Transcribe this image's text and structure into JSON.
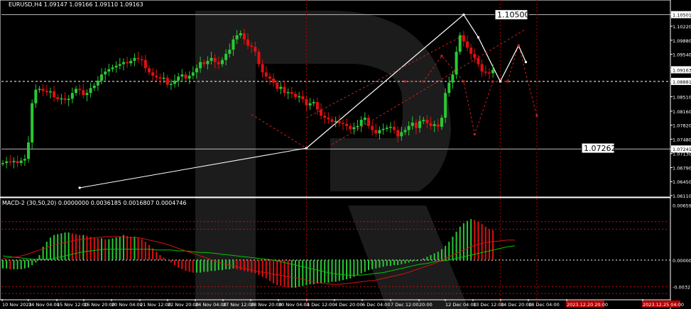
{
  "colors": {
    "background": "#000000",
    "bull": "#29c934",
    "bear": "#e01010",
    "axis_text": "#ffffff",
    "hline": "#ffffff",
    "forecast_white": "#ffffff",
    "forecast_red": "#cc1f1f",
    "macd_signal": "#00c800",
    "macd_line": "#d21414",
    "level_red": "#c41010",
    "vline_red": "#b00000"
  },
  "header": {
    "symbol_info": "EURUSD,H4  1.09147 1.09166 1.09110 1.09163",
    "macd_info": "MACD-2 (30,50,20) 0.0000000 0.0036185 0.0016807 0.0004746"
  },
  "chart_data": [
    {
      "type": "line",
      "name": "price",
      "ylim": [
        1.0611,
        1.1065
      ],
      "price_axis_labels": [
        "1.10501",
        "1.10220",
        "1.09880",
        "1.09540",
        "1.09163",
        "1.08881",
        "1.08510",
        "1.08160",
        "1.07820",
        "1.07480",
        "1.07241",
        "1.07130",
        "1.06790",
        "1.06450",
        "1.06110"
      ],
      "price_axis_values": [
        1.10501,
        1.1022,
        1.0988,
        1.0954,
        1.09163,
        1.08881,
        1.0851,
        1.0816,
        1.0782,
        1.0748,
        1.07241,
        1.0713,
        1.0679,
        1.0645,
        1.0611
      ],
      "highlighted_prices": [
        "1.10501",
        "1.09163",
        "1.08881",
        "1.07241"
      ],
      "level_lines": [
        1.10501,
        1.08881,
        1.07241
      ],
      "annotations": [
        {
          "text": "1.10500",
          "price": 1.105
        },
        {
          "text": "1.07262",
          "price": 1.07262
        }
      ],
      "x_tick_labels": [
        "10 Nov 2023",
        "14 Nov 04:00",
        "15 Nov 12:00",
        "16 Nov 20:00",
        "20 Nov 04:00",
        "21 Nov 12:00",
        "22 Nov 20:00",
        "24 Nov 04:00",
        "27 Nov 12:00",
        "28 Nov 20:00",
        "30 Nov 04:00",
        "1 Dec 12:00",
        "4 Dec 20:00",
        "6 Dec 04:00",
        "7 Dec 12:00",
        "20:00",
        "12 Dec 04:00",
        "13 Dec 12:00",
        "14 Dec 20:00",
        "18 Dec 04:00",
        "2023.12.20 20:00",
        "2023.12.25 04:00"
      ],
      "red_x_tags": [
        "2023.12.07 12:00",
        "2023.12.20 20:00",
        "2023.12.25 04:00"
      ],
      "close_series": [
        1.069,
        1.0694,
        1.0692,
        1.0695,
        1.069,
        1.0696,
        1.07,
        1.074,
        1.0835,
        1.0868,
        1.087,
        1.0865,
        1.0862,
        1.0864,
        1.085,
        1.0845,
        1.0847,
        1.0843,
        1.0846,
        1.086,
        1.087,
        1.0867,
        1.0855,
        1.086,
        1.0872,
        1.0878,
        1.089,
        1.0905,
        1.0912,
        1.0918,
        1.0922,
        1.0926,
        1.093,
        1.0935,
        1.0932,
        1.0938,
        1.0945,
        1.0942,
        1.094,
        1.092,
        1.091,
        1.0902,
        1.0898,
        1.0895,
        1.0897,
        1.088,
        1.0882,
        1.089,
        1.09,
        1.0905,
        1.0895,
        1.0902,
        1.091,
        1.092,
        1.0935,
        1.093,
        1.0938,
        1.0945,
        1.0935,
        1.093,
        1.094,
        1.0955,
        1.0965,
        1.099,
        1.1,
        1.1005,
        1.099,
        1.0975,
        1.0972,
        1.096,
        1.093,
        1.091,
        1.09,
        1.0895,
        1.0885,
        1.087,
        1.0875,
        1.086,
        1.0862,
        1.0858,
        1.085,
        1.0852,
        1.0845,
        1.083,
        1.0835,
        1.0838,
        1.082,
        1.0805,
        1.08,
        1.0796,
        1.079,
        1.0792,
        1.0787,
        1.0785,
        1.078,
        1.0772,
        1.0777,
        1.078,
        1.0795,
        1.08,
        1.078,
        1.077,
        1.0762,
        1.077,
        1.0773,
        1.0776,
        1.0778,
        1.077,
        1.0755,
        1.0765,
        1.077,
        1.078,
        1.0788,
        1.0775,
        1.0792,
        1.0795,
        1.0787,
        1.078,
        1.0784,
        1.0778,
        1.08,
        1.086,
        1.0885,
        1.0905,
        1.096,
        1.1,
        1.0985,
        1.097,
        1.0955,
        1.0945,
        1.093,
        1.0912,
        1.091,
        1.0908,
        1.0916
      ],
      "forecast_white_path": [
        {
          "bar": 83,
          "price": 1.07262
        },
        {
          "bar": 126,
          "price": 1.105
        },
        {
          "bar": 130,
          "price": 1.0995
        },
        {
          "bar": 136,
          "price": 1.0888
        },
        {
          "bar": 141,
          "price": 1.0975
        },
        {
          "bar": 143,
          "price": 1.0935
        }
      ],
      "forecast_red_path": [
        {
          "bar": 110,
          "price": 1.0888
        },
        {
          "bar": 115,
          "price": 1.0888
        },
        {
          "bar": 120,
          "price": 1.095
        },
        {
          "bar": 126,
          "price": 1.0888
        },
        {
          "bar": 129,
          "price": 1.076
        },
        {
          "bar": 134,
          "price": 1.0888
        },
        {
          "bar": 138,
          "price": 1.0888
        },
        {
          "bar": 141,
          "price": 1.0975
        },
        {
          "bar": 146,
          "price": 1.0805
        }
      ],
      "long_white_line": [
        {
          "bar": 21,
          "price": 1.063
        },
        {
          "bar": 83,
          "price": 1.07262
        }
      ]
    },
    {
      "type": "bar",
      "name": "MACD-2 (30,50,20)",
      "ylim": [
        -0.0045,
        0.0067
      ],
      "axis_labels": [
        "0.0065927",
        "0.0000014",
        "-0.0032"
      ],
      "histogram": [
        -0.001,
        -0.001,
        -0.0011,
        -0.0011,
        -0.0011,
        -0.0011,
        -0.001,
        -0.0009,
        -0.0006,
        -0.0003,
        0.0006,
        0.0016,
        0.0022,
        0.0027,
        0.003,
        0.0031,
        0.0032,
        0.0033,
        0.0033,
        0.0032,
        0.0031,
        0.003,
        0.003,
        0.0029,
        0.0028,
        0.0027,
        0.0026,
        0.0026,
        0.0025,
        0.0025,
        0.0026,
        0.0027,
        0.0028,
        0.003,
        0.0029,
        0.0028,
        0.0028,
        0.0027,
        0.0025,
        0.0022,
        0.0018,
        0.0014,
        0.001,
        0.0006,
        0.0003,
        0.0,
        -0.0003,
        -0.0006,
        -0.0009,
        -0.0011,
        -0.0013,
        -0.0014,
        -0.0015,
        -0.0015,
        -0.0015,
        -0.0014,
        -0.0014,
        -0.0013,
        -0.0013,
        -0.0012,
        -0.0012,
        -0.0011,
        -0.0011,
        -0.001,
        -0.0011,
        -0.0012,
        -0.0013,
        -0.0014,
        -0.0015,
        -0.0016,
        -0.0018,
        -0.002,
        -0.0022,
        -0.0025,
        -0.0028,
        -0.003,
        -0.0031,
        -0.0032,
        -0.0033,
        -0.0033,
        -0.0033,
        -0.0032,
        -0.0031,
        -0.003,
        -0.0029,
        -0.0029,
        -0.0028,
        -0.0028,
        -0.0027,
        -0.0027,
        -0.0026,
        -0.0026,
        -0.0025,
        -0.0024,
        -0.0023,
        -0.0022,
        -0.002,
        -0.0018,
        -0.0016,
        -0.0014,
        -0.0012,
        -0.0011,
        -0.001,
        -0.0009,
        -0.0008,
        -0.0007,
        -0.0007,
        -0.0006,
        -0.0006,
        -0.0005,
        -0.0004,
        -0.0003,
        -0.0002,
        -0.0001,
        0.0,
        0.0002,
        0.0004,
        0.0006,
        0.0008,
        0.001,
        0.0013,
        0.0017,
        0.0022,
        0.0028,
        0.0034,
        0.004,
        0.0044,
        0.0047,
        0.0049,
        0.0048,
        0.0046,
        0.0043,
        0.004,
        0.0037,
        0.0036
      ],
      "signal_line": [
        0.0005,
        0.0004,
        0.0003,
        0.0002,
        0.0001,
        0.0001,
        0.0001,
        0.0002,
        0.0004,
        0.0006,
        0.0008,
        0.001,
        0.0011,
        0.0012,
        0.0013,
        0.0013,
        0.0013,
        0.0013,
        0.0013,
        0.0013,
        0.0013,
        0.0012,
        0.0012,
        0.0012,
        0.0011,
        0.0011,
        0.001,
        0.0009,
        0.0009,
        0.0008,
        0.0007,
        0.0006,
        0.0005,
        0.0004,
        0.0003,
        0.0002,
        0.0001,
        0.0,
        -0.0002,
        -0.0004,
        -0.0006,
        -0.0008,
        -0.001,
        -0.0012,
        -0.0014,
        -0.0016,
        -0.0017,
        -0.0018,
        -0.0018,
        -0.0018,
        -0.0017,
        -0.0016,
        -0.0015,
        -0.0013,
        -0.0011,
        -0.0009,
        -0.0007,
        -0.0005,
        -0.0004,
        -0.0002,
        -0.0001,
        0.0,
        0.0002,
        0.0004,
        0.0006,
        0.0008,
        0.001,
        0.0012,
        0.0014,
        0.0016,
        0.0017
      ],
      "macd_line": [
        0.0002,
        0.0003,
        0.0004,
        0.0006,
        0.0009,
        0.0012,
        0.0015,
        0.0018,
        0.002,
        0.0022,
        0.0024,
        0.0025,
        0.0026,
        0.0027,
        0.0028,
        0.0028,
        0.0028,
        0.0027,
        0.0027,
        0.0026,
        0.0024,
        0.0022,
        0.002,
        0.0017,
        0.0014,
        0.0011,
        0.0008,
        0.0005,
        0.0002,
        -0.0001,
        -0.0004,
        -0.0006,
        -0.0008,
        -0.001,
        -0.0012,
        -0.0014,
        -0.0015,
        -0.0017,
        -0.0018,
        -0.002,
        -0.0021,
        -0.0023,
        -0.0025,
        -0.0027,
        -0.0028,
        -0.0029,
        -0.0029,
        -0.0028,
        -0.0027,
        -0.0026,
        -0.0025,
        -0.0024,
        -0.0022,
        -0.002,
        -0.0018,
        -0.0016,
        -0.0013,
        -0.001,
        -0.0007,
        -0.0004,
        0.0,
        0.0004,
        0.0008,
        0.0012,
        0.0016,
        0.0019,
        0.0021,
        0.0022,
        0.0023,
        0.0024,
        0.0024
      ]
    }
  ]
}
